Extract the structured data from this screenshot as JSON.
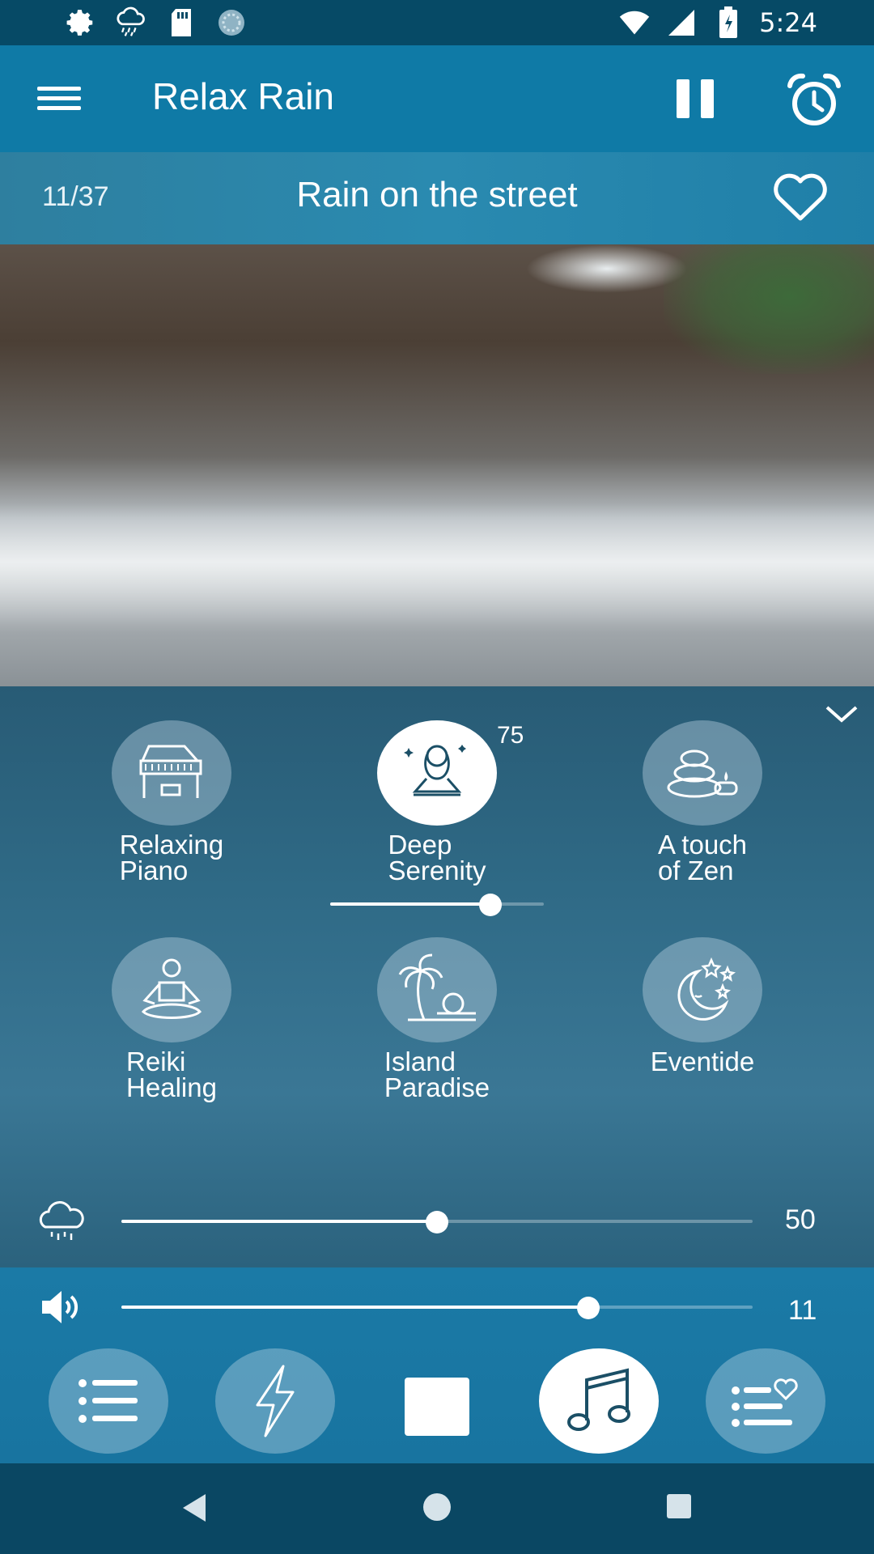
{
  "status_bar": {
    "time": "5:24",
    "icons": [
      "settings-icon",
      "weather-icon",
      "sd-card-icon",
      "sync-icon",
      "wifi-icon",
      "signal-icon",
      "battery-icon"
    ]
  },
  "app_bar": {
    "title": "Relax Rain",
    "actions": [
      "menu-icon",
      "pause-icon",
      "alarm-icon"
    ]
  },
  "track": {
    "counter": "11/37",
    "title": "Rain on the street"
  },
  "sounds": [
    {
      "label_line1": "Relaxing",
      "label_line2": "Piano",
      "icon": "piano-icon"
    },
    {
      "label_line1": "Deep",
      "label_line2": "Serenity",
      "icon": "meditation-icon",
      "active": true,
      "volume": "75",
      "volume_fraction": 0.75
    },
    {
      "label_line1": "A touch",
      "label_line2": "of Zen",
      "icon": "zen-stones-icon"
    },
    {
      "label_line1": "Reiki",
      "label_line2": "Healing",
      "icon": "reiki-icon"
    },
    {
      "label_line1": "Island",
      "label_line2": "Paradise",
      "icon": "palm-tree-icon"
    },
    {
      "label_line1": "Eventide",
      "label_line2": "",
      "icon": "moon-stars-icon"
    }
  ],
  "rain_volume": {
    "value": "50",
    "fraction": 0.5,
    "icon": "rain-cloud-icon"
  },
  "master_volume": {
    "value": "11",
    "fraction": 0.74,
    "icon": "speaker-icon"
  },
  "bottom_nav": [
    "list-icon",
    "lightning-icon",
    "stop-icon",
    "music-icon",
    "favorites-list-icon"
  ],
  "colors": {
    "accent": "#0f7aa6",
    "panel": "#2f6a86",
    "status": "#064a66"
  }
}
